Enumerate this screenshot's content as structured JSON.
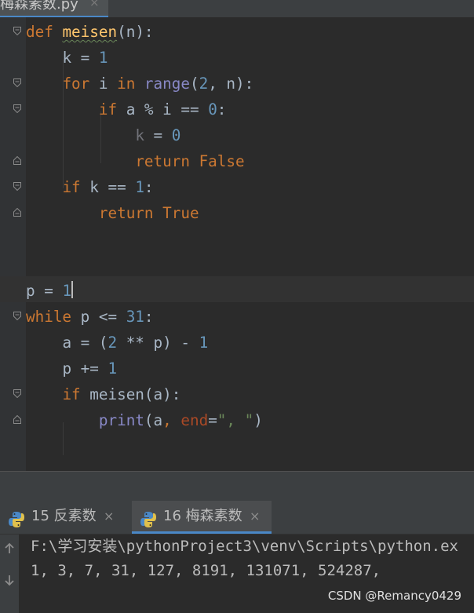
{
  "editor_tab": {
    "file_name": "梅森素数.py",
    "close_glyph": "×"
  },
  "code": {
    "l1": {
      "kw": "def",
      "fn": "meisen",
      "open": "(",
      "param": "n",
      "close": "):"
    },
    "l2": {
      "a": "k = ",
      "num": "1"
    },
    "l3": {
      "kw1": "for",
      "a": " i ",
      "kw2": "in",
      "sp": " ",
      "bi": "range",
      "b": "(",
      "num": "2",
      "c": ", n):"
    },
    "l4": {
      "kw": "if",
      "a": " a % i == ",
      "num": "0",
      "b": ":"
    },
    "l5": {
      "var": "k",
      "a": " = ",
      "num": "0"
    },
    "l6": {
      "kw": "return",
      "sp": " ",
      "kw2": "False"
    },
    "l7": {
      "kw": "if",
      "a": " k == ",
      "num": "1",
      "b": ":"
    },
    "l8": {
      "kw": "return",
      "sp": " ",
      "kw2": "True"
    },
    "l9": {
      "a": "p = ",
      "num": "1"
    },
    "l10": {
      "kw": "while",
      "a": " p <= ",
      "num": "31",
      "b": ":"
    },
    "l11": {
      "a": "a = (",
      "num1": "2",
      "b": " ** p) - ",
      "num2": "1"
    },
    "l12": {
      "a": "p += ",
      "num": "1"
    },
    "l13": {
      "kw": "if",
      "a": " meisen(a):"
    },
    "l14": {
      "bi": "print",
      "a": "(a",
      "comma": ", ",
      "param": "end",
      "eq": "=",
      "str": "\", \"",
      "b": ")"
    }
  },
  "run_tabs": [
    {
      "label": "15 反素数",
      "close_glyph": "×",
      "active": false
    },
    {
      "label": "16 梅森素数",
      "close_glyph": "×",
      "active": true
    }
  ],
  "console": {
    "command": "F:\\学习安装\\pythonProject3\\venv\\Scripts\\python.ex",
    "output": "1, 3, 7, 31, 127, 8191, 131071, 524287,"
  },
  "watermark": "CSDN @Remancy0429",
  "colors": {
    "background": "#2b2b2b",
    "keyword": "#cc7832",
    "number": "#6897bb",
    "function": "#ffc66d",
    "string": "#6a8759",
    "builtin": "#8888c6",
    "accent": "#4a88c7"
  },
  "icons": [
    "python-icon",
    "fold-start-icon",
    "fold-end-icon",
    "arrow-up-icon",
    "arrow-down-icon"
  ]
}
